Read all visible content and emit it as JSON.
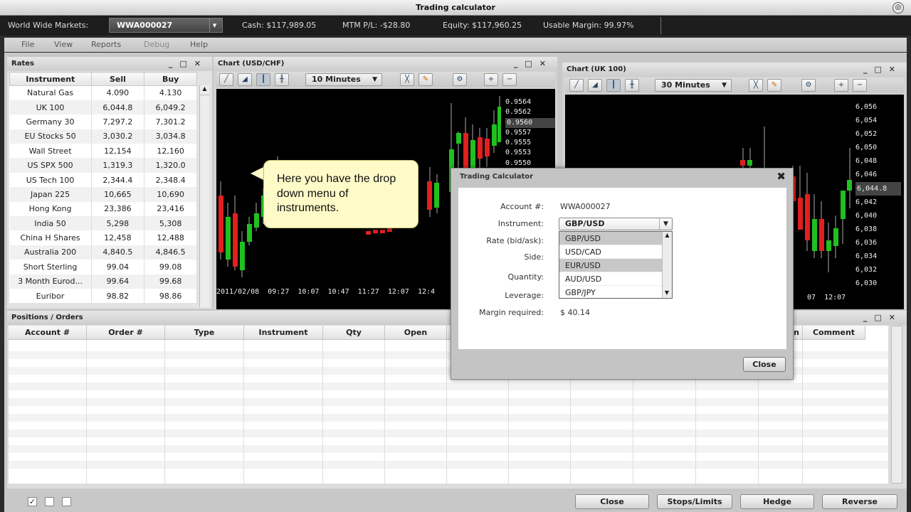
{
  "window": {
    "title": "Trading calculator",
    "control": "◎"
  },
  "topbar": {
    "label": "World Wide Markets:",
    "account": "WWA000027",
    "cash": "Cash: $117,989.05",
    "mtm": "MTM P/L: -$28.80",
    "equity": "Equity: $117,960.25",
    "margin": "Usable Margin: 99.97%"
  },
  "menu": {
    "file": "File",
    "view": "View",
    "reports": "Reports",
    "debug": "Debug",
    "help": "Help"
  },
  "rates": {
    "title": "Rates",
    "headers": [
      "Instrument",
      "Sell",
      "Buy"
    ],
    "rows": [
      [
        "Natural Gas",
        "4.090",
        "4.130"
      ],
      [
        "UK 100",
        "6,044.8",
        "6,049.2"
      ],
      [
        "Germany 30",
        "7,297.2",
        "7,301.2"
      ],
      [
        "EU Stocks 50",
        "3,030.2",
        "3,034.8"
      ],
      [
        "Wall Street",
        "12,154",
        "12,160"
      ],
      [
        "US SPX 500",
        "1,319.3",
        "1,320.0"
      ],
      [
        "US Tech 100",
        "2,344.4",
        "2,348.4"
      ],
      [
        "Japan 225",
        "10,665",
        "10,690"
      ],
      [
        "Hong Kong",
        "23,386",
        "23,416"
      ],
      [
        "India 50",
        "5,298",
        "5,308"
      ],
      [
        "China H Shares",
        "12,458",
        "12,488"
      ],
      [
        "Australia 200",
        "4,840.5",
        "4,846.5"
      ],
      [
        "Short Sterling",
        "99.04",
        "99.08"
      ],
      [
        "3 Month Eurod...",
        "99.64",
        "99.68"
      ],
      [
        "Euribor",
        "98.82",
        "98.86"
      ]
    ]
  },
  "chart1": {
    "title": "Chart (USD/CHF)",
    "interval": "10 Minutes",
    "prices": [
      "0.9564",
      "0.9562",
      "0.9560",
      "0.9557",
      "0.9555",
      "0.9553",
      "0.9550"
    ],
    "times": "2011/02/08  09:27  10:07  10:47  11:27  12:07  12:4"
  },
  "chart2": {
    "title": "Chart (UK 100)",
    "interval": "30 Minutes",
    "prices": [
      "6,056",
      "6,054",
      "6,052",
      "6,050",
      "6,048",
      "6,046",
      "6,044.8",
      "6,042",
      "6,040",
      "6,038",
      "6,036",
      "6,034",
      "6,032",
      "6,030"
    ],
    "times": "07  12:07"
  },
  "callout": {
    "text": "Here you have the drop down menu of instruments."
  },
  "dialog": {
    "title": "Trading Calculator",
    "close_x": "✖",
    "account_label": "Account #:",
    "account_value": "WWA000027",
    "instrument_label": "Instrument:",
    "instrument_value": "GBP/USD",
    "rate_label": "Rate (bid/ask):",
    "side_label": "Side:",
    "quantity_label": "Quantity:",
    "leverage_label": "Leverage:",
    "margin_label": "Margin required:",
    "margin_value": "$ 40.14",
    "options": [
      "GBP/USD",
      "USD/CAD",
      "EUR/USD",
      "AUD/USD",
      "GBP/JPY"
    ],
    "close_button": "Close"
  },
  "positions": {
    "title": "Positions / Orders",
    "headers": [
      "Account #",
      "Order #",
      "Type",
      "Instrument",
      "Qty",
      "Open",
      "",
      "",
      "",
      "",
      "in",
      "Comment"
    ]
  },
  "bottom": {
    "close": "Close",
    "stops": "Stops/Limits",
    "hedge": "Hedge",
    "reverse": "Reverse"
  }
}
